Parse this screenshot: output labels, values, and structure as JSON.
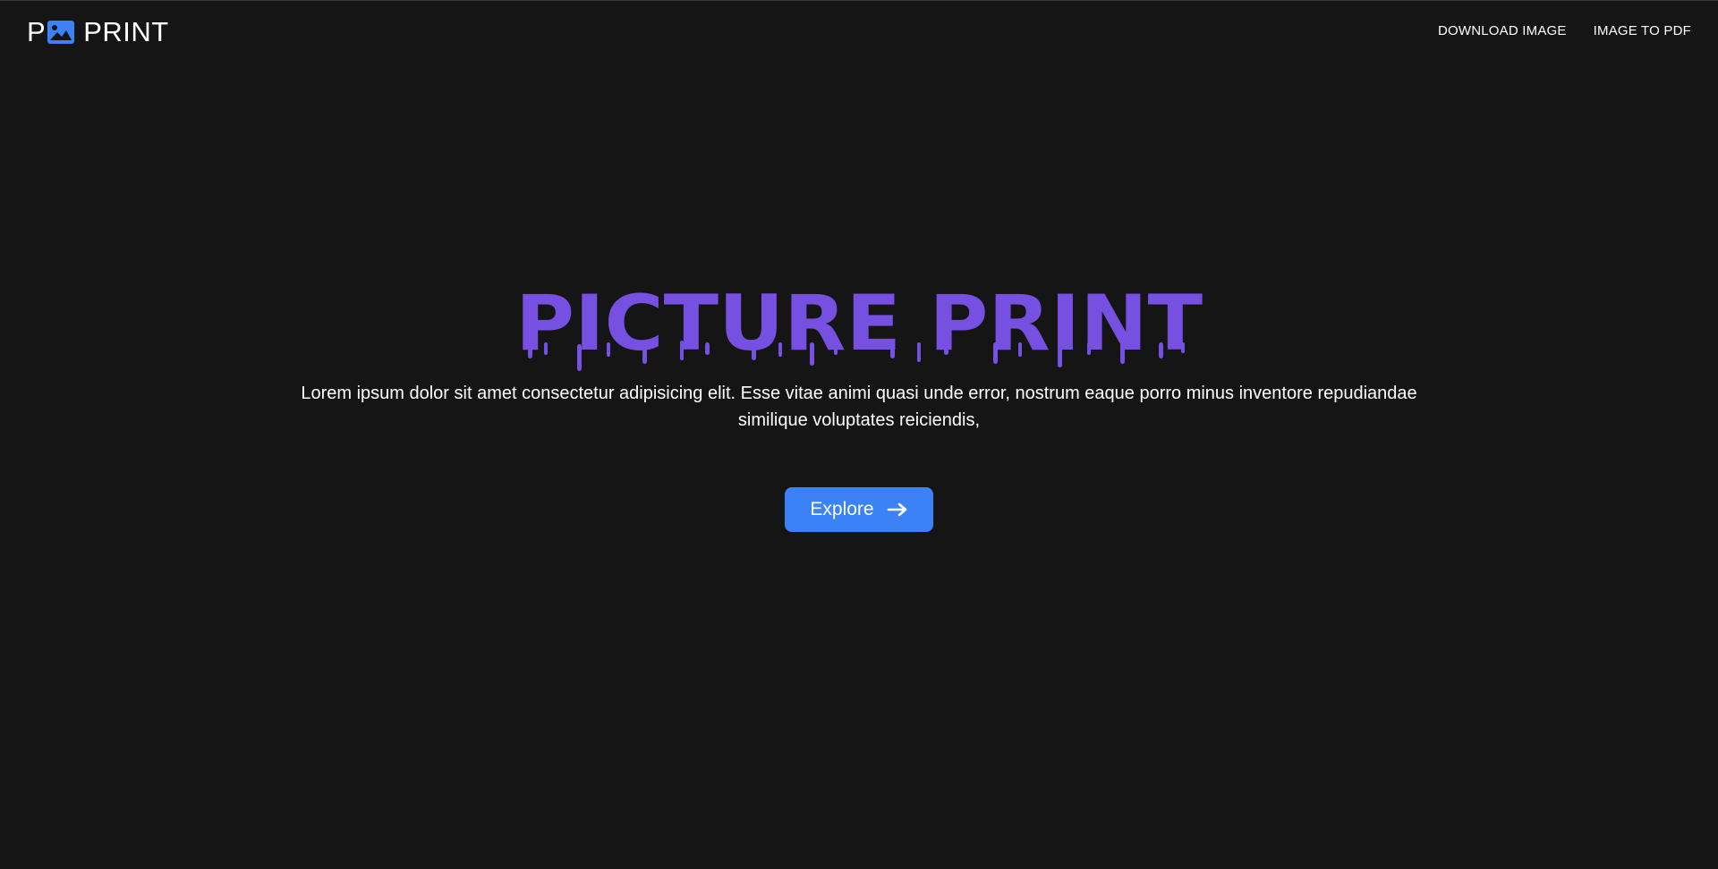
{
  "brand": {
    "name_prefix": "P",
    "name_suffix": "PRINT",
    "logo_icon": "image-icon",
    "icon_color": "#3b82f6"
  },
  "nav": {
    "links": [
      {
        "label": "DOWNLOAD IMAGE"
      },
      {
        "label": "IMAGE TO PDF"
      }
    ]
  },
  "hero": {
    "title": "PICTURE PRINT",
    "title_color": "#7650e0",
    "description": "Lorem ipsum dolor sit amet consectetur adipisicing elit. Esse vitae animi quasi unde error, nostrum eaque porro minus inventore repudiandae similique voluptates reiciendis,",
    "cta": {
      "label": "Explore",
      "icon": "arrow-right-icon",
      "color": "#3b82f6"
    }
  },
  "colors": {
    "background": "#151515",
    "text": "#ffffff"
  }
}
